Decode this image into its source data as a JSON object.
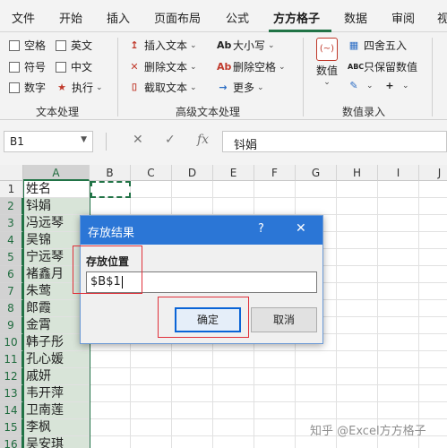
{
  "tabs": [
    "文件",
    "开始",
    "插入",
    "页面布局",
    "公式",
    "方方格子",
    "数据",
    "审阅",
    "视"
  ],
  "active_tab": "方方格子",
  "ribbon": {
    "text_group": {
      "label": "文本处理",
      "items": [
        "空格",
        "英文",
        "符号",
        "中文",
        "数字",
        "执行"
      ]
    },
    "adv_group": {
      "label": "高级文本处理",
      "items": [
        "插入文本",
        "删除文本",
        "截取文本",
        "大小写",
        "删除空格",
        "更多"
      ]
    },
    "entry_group": {
      "label": "数值录入",
      "big_button": "数值",
      "items": [
        "四舍五入",
        "只保留数值"
      ]
    }
  },
  "formula_bar": {
    "name_box": "B1",
    "fx": "fx",
    "content": "钭娟"
  },
  "columns": [
    "A",
    "B",
    "C",
    "D",
    "E",
    "F",
    "G",
    "H",
    "I",
    "J"
  ],
  "rows": [
    "1",
    "2",
    "3",
    "4",
    "5",
    "6",
    "7",
    "8",
    "9",
    "10",
    "11",
    "12",
    "13",
    "14",
    "15",
    "16"
  ],
  "col_a_values": [
    "姓名",
    "钭娟",
    "冯远琴",
    "吴锦",
    "宁远琴",
    "褚鑫月",
    "朱莺",
    "郎霞",
    "金霄",
    "韩子彤",
    "孔心媛",
    "戚妍",
    "韦开萍",
    "卫南莲",
    "李枫",
    "吴安琪"
  ],
  "dialog": {
    "title": "存放结果",
    "help": "?",
    "close": "✕",
    "field_label": "存放位置",
    "field_value": "$B$1",
    "ok": "确定",
    "cancel": "取消"
  },
  "watermark": "知乎 @Excel方方格子"
}
